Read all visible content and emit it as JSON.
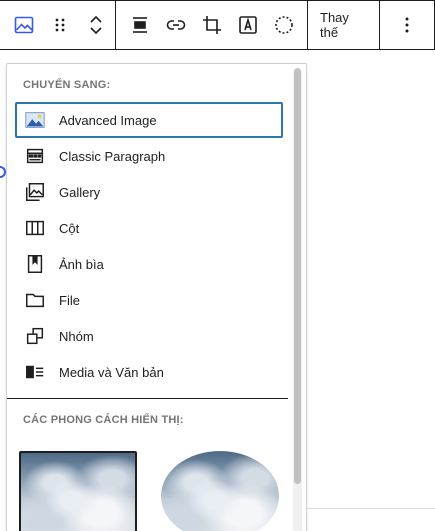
{
  "toolbar": {
    "replace_label": "Thay thế",
    "icons": [
      "image-icon",
      "drag-handle-icon",
      "move-up-down-icon",
      "align-icon",
      "link-icon",
      "crop-icon",
      "text-overlay-icon",
      "circle-dashed-icon",
      "more-vertical-icon"
    ]
  },
  "transform": {
    "section_title": "CHUYỂN SANG:",
    "items": [
      {
        "label": "Advanced Image",
        "icon": "advanced-image-icon"
      },
      {
        "label": "Classic Paragraph",
        "icon": "classic-paragraph-icon"
      },
      {
        "label": "Gallery",
        "icon": "gallery-icon"
      },
      {
        "label": "Cột",
        "icon": "columns-icon"
      },
      {
        "label": "Ảnh bìa",
        "icon": "cover-icon"
      },
      {
        "label": "File",
        "icon": "file-icon"
      },
      {
        "label": "Nhóm",
        "icon": "group-icon"
      },
      {
        "label": "Media và Văn bản",
        "icon": "media-text-icon"
      }
    ]
  },
  "styles": {
    "section_title": "CÁC PHONG CÁCH HIỂN THỊ:",
    "options": [
      "default-style",
      "rounded-style"
    ]
  },
  "colors": {
    "accent": "#3858e9",
    "focus": "#2a7aa8",
    "text": "#1e1e1e",
    "muted": "#757575"
  }
}
